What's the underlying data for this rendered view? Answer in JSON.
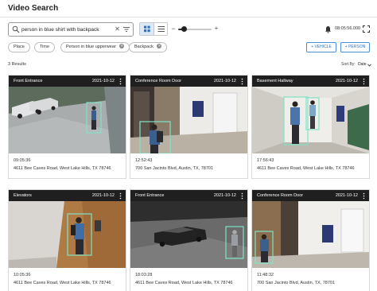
{
  "app": {
    "title": "Video Search"
  },
  "search": {
    "value": "person in blue shirt with backpack",
    "placeholder": "Search"
  },
  "view": {
    "active": "grid"
  },
  "zoom": {
    "level": 0.18
  },
  "header_right": {
    "timecode": "08:05:56.000"
  },
  "filters": [
    {
      "label": "Place",
      "removable": false
    },
    {
      "label": "Time",
      "removable": false
    },
    {
      "label": "Person in blue upperwear",
      "removable": true
    },
    {
      "label": "Backpack",
      "removable": true
    }
  ],
  "actions": {
    "add_vehicle": "+ VEHICLE",
    "add_person": "+ PERSON"
  },
  "results": {
    "count_label": "3 Results"
  },
  "sort": {
    "label": "Sort By:",
    "value": "Date"
  },
  "colors": {
    "header_bg": "#1f1f1f",
    "detection_box": "#7fe3c6",
    "accent": "#2f74c4"
  },
  "cards": [
    {
      "location": "Front Entrance",
      "date": "2021-10-12",
      "time": "09:05:36",
      "address": "4611 Bee Caves Road, West Lake Hills, TX 78746"
    },
    {
      "location": "Conference Room Door",
      "date": "2021-10-12",
      "time": "12:52:43",
      "address": "700 San Jacinto Blvd, Austin, TX, 78701"
    },
    {
      "location": "Basement Hallway",
      "date": "2021-10-12",
      "time": "17:56:43",
      "address": "4611 Bee Caves Road, West Lake Hills, TX 78746"
    },
    {
      "location": "Elevators",
      "date": "2021-10-12",
      "time": "10:05:36",
      "address": "4611 Bee Caves Road, West Lake Hills, TX 78746"
    },
    {
      "location": "Front Entrance",
      "date": "2021-10-12",
      "time": "18:03:28",
      "address": "4611 Bee Caves Road, West Lake Hills, TX 78746"
    },
    {
      "location": "Conference Room Door",
      "date": "2021-10-12",
      "time": "11:48:32",
      "address": "700 San Jacinto Blvd, Austin, TX, 78701"
    }
  ]
}
